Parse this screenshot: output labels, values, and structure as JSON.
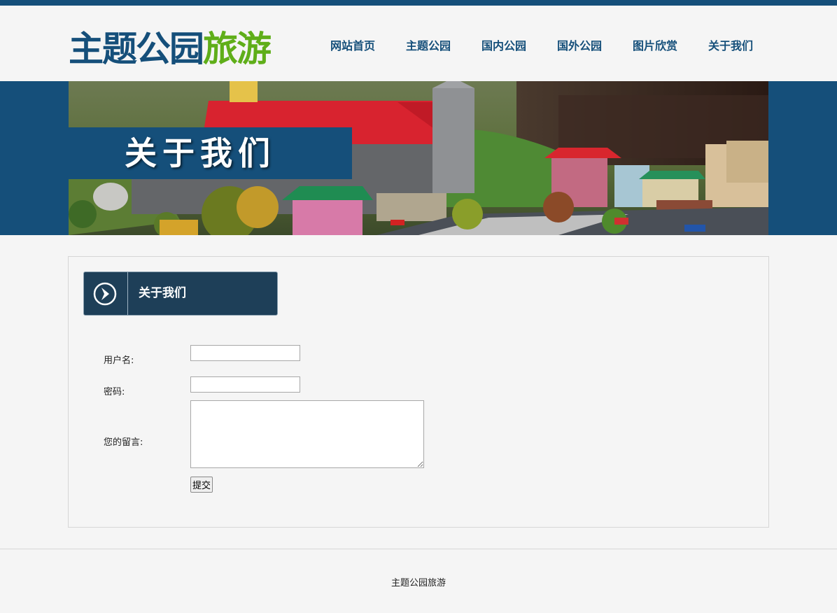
{
  "logo": {
    "part1": "主题公园",
    "part2": "旅游"
  },
  "nav": [
    "网站首页",
    "主题公园",
    "国内公园",
    "国外公园",
    "图片欣赏",
    "关于我们"
  ],
  "banner": {
    "label": "关于我们"
  },
  "section": {
    "title": "关于我们"
  },
  "form": {
    "username_label": "用户名:",
    "password_label": "密码:",
    "message_label": "您的留言:",
    "username_value": "",
    "password_value": "",
    "message_value": "",
    "submit_label": "提交"
  },
  "footer": {
    "text": "主题公园旅游"
  },
  "colors": {
    "primary": "#154f7a",
    "accent": "#5fae19",
    "section_head": "#1e3f58"
  },
  "icons": {
    "section_icon": "chevron-right-circle-icon"
  }
}
